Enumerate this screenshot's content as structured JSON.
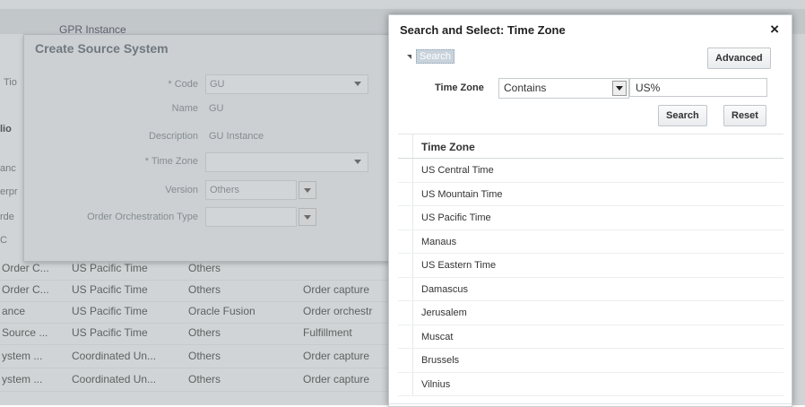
{
  "background": {
    "header_title": "GPR Instance",
    "side_labels": [
      "Tio",
      "lio",
      "anc",
      "erpr",
      "rde",
      "C"
    ],
    "rows": [
      {
        "name": "Order C...",
        "timezone": "US Pacific Time",
        "type": "Others",
        "purpose": ""
      },
      {
        "name": "Order C...",
        "timezone": "US Pacific Time",
        "type": "Others",
        "purpose": "Order capture"
      },
      {
        "name": "ance",
        "timezone": "US Pacific Time",
        "type": "Oracle Fusion",
        "purpose": "Order orchestr"
      },
      {
        "name": "Source ...",
        "timezone": "US Pacific Time",
        "type": "Others",
        "purpose": "Fulfillment"
      },
      {
        "name": "ystem ...",
        "timezone": "Coordinated Un...",
        "type": "Others",
        "purpose": "Order capture"
      },
      {
        "name": "ystem ...",
        "timezone": "Coordinated Un...",
        "type": "Others",
        "purpose": "Order capture"
      }
    ]
  },
  "create_dialog": {
    "title": "Create Source System",
    "fields": {
      "code_label": "* Code",
      "code_value": "GU",
      "name_label": "Name",
      "name_value": "GU",
      "description_label": "Description",
      "description_value": "GU Instance",
      "timezone_label": "* Time Zone",
      "version_label": "Version",
      "version_value": "Others",
      "order_type_label": "Order Orchestration Type"
    }
  },
  "search_dialog": {
    "title": "Search and Select: Time Zone",
    "close_icon": "×",
    "search_toggle_label": "Search",
    "advanced_button": "Advanced",
    "timezone_label": "Time Zone",
    "operator_value": "Contains",
    "query_value": "US%",
    "search_button": "Search",
    "reset_button": "Reset",
    "column_header": "Time Zone",
    "results": [
      "US Central Time",
      "US Mountain Time",
      "US Pacific Time",
      "Manaus",
      "US Eastern Time",
      "Damascus",
      "Jerusalem",
      "Muscat",
      "Brussels",
      "Vilnius"
    ]
  }
}
